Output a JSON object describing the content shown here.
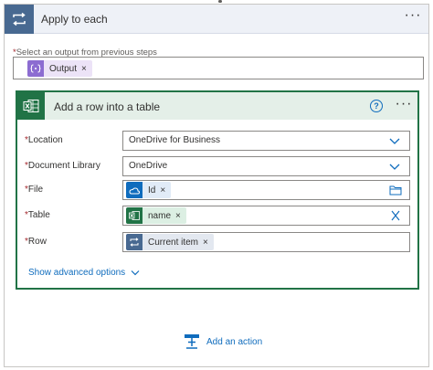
{
  "loop": {
    "title": "Apply to each",
    "more_label": "···"
  },
  "select_output": {
    "required_mark": "*",
    "label": "Select an output from previous steps",
    "token": {
      "label": "Output",
      "remove": "×"
    }
  },
  "action_card": {
    "title": "Add a row into a table",
    "help_label": "?",
    "more_label": "···",
    "fields": [
      {
        "required_mark": "*",
        "label": "Location",
        "value": "OneDrive for Business"
      },
      {
        "required_mark": "*",
        "label": "Document Library",
        "value": "OneDrive"
      },
      {
        "required_mark": "*",
        "label": "File",
        "token": {
          "label": "Id",
          "remove": "×"
        }
      },
      {
        "required_mark": "*",
        "label": "Table",
        "token": {
          "label": "name",
          "remove": "×"
        }
      },
      {
        "required_mark": "*",
        "label": "Row",
        "token": {
          "label": "Current item",
          "remove": "×"
        }
      }
    ],
    "advanced_label": "Show advanced options"
  },
  "add_action": {
    "label": "Add an action"
  },
  "colors": {
    "loop_accent": "#486991",
    "excel_green": "#217346",
    "link_blue": "#0f6cbd",
    "required_red": "#a4262c",
    "expression_purple": "#8c6cd1"
  }
}
